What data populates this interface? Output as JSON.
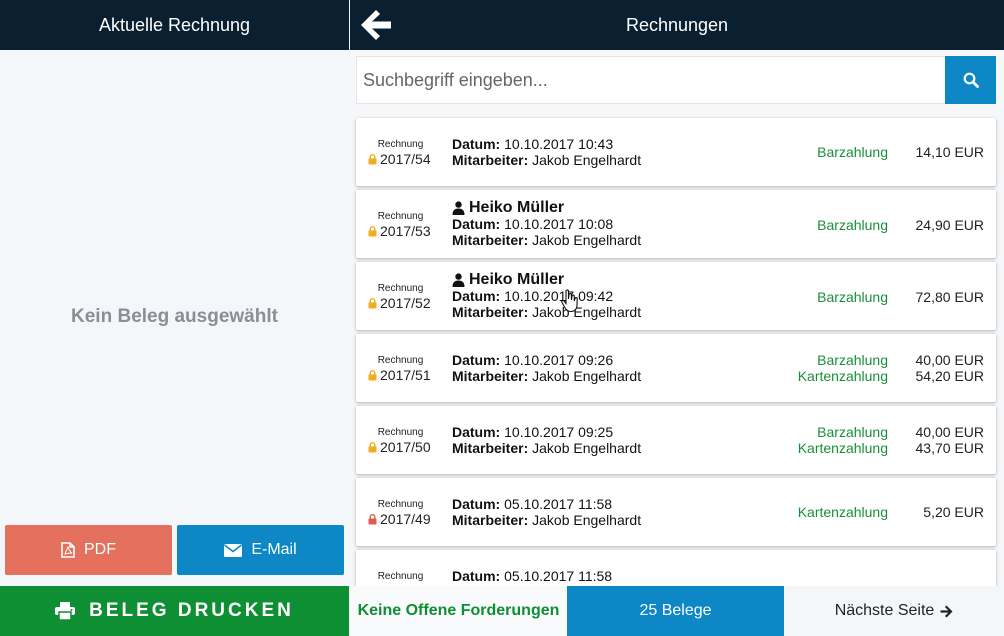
{
  "left": {
    "title": "Aktuelle Rechnung",
    "empty_message": "Kein Beleg ausgewählt",
    "pdf_label": "PDF",
    "email_label": "E-Mail",
    "print_label": "BELEG DRUCKEN"
  },
  "right": {
    "title": "Rechnungen",
    "search_placeholder": "Suchbegriff eingeben..."
  },
  "labels": {
    "datum": "Datum:",
    "mitarbeiter": "Mitarbeiter:"
  },
  "invoices": [
    {
      "type": "Rechnung",
      "number": "2017/54",
      "lock_color": "#f0ad1e",
      "customer": "",
      "datum": "10.10.2017 10:43",
      "mitarbeiter": "Jakob Engelhardt",
      "payments": [
        "Barzahlung"
      ],
      "amounts": [
        "14,10 EUR"
      ]
    },
    {
      "type": "Rechnung",
      "number": "2017/53",
      "lock_color": "#f0ad1e",
      "customer": "Heiko Müller",
      "datum": "10.10.2017 10:08",
      "mitarbeiter": "Jakob Engelhardt",
      "payments": [
        "Barzahlung"
      ],
      "amounts": [
        "24,90 EUR"
      ]
    },
    {
      "type": "Rechnung",
      "number": "2017/52",
      "lock_color": "#f0ad1e",
      "customer": "Heiko Müller",
      "datum": "10.10.2017 09:42",
      "mitarbeiter": "Jakob Engelhardt",
      "payments": [
        "Barzahlung"
      ],
      "amounts": [
        "72,80 EUR"
      ]
    },
    {
      "type": "Rechnung",
      "number": "2017/51",
      "lock_color": "#f0ad1e",
      "customer": "",
      "datum": "10.10.2017 09:26",
      "mitarbeiter": "Jakob Engelhardt",
      "payments": [
        "Barzahlung",
        "Kartenzahlung"
      ],
      "amounts": [
        "40,00 EUR",
        "54,20 EUR"
      ]
    },
    {
      "type": "Rechnung",
      "number": "2017/50",
      "lock_color": "#f0ad1e",
      "customer": "",
      "datum": "10.10.2017 09:25",
      "mitarbeiter": "Jakob Engelhardt",
      "payments": [
        "Barzahlung",
        "Kartenzahlung"
      ],
      "amounts": [
        "40,00 EUR",
        "43,70 EUR"
      ]
    },
    {
      "type": "Rechnung",
      "number": "2017/49",
      "lock_color": "#e05a4e",
      "customer": "",
      "datum": "05.10.2017 11:58",
      "mitarbeiter": "Jakob Engelhardt",
      "payments": [
        "Kartenzahlung"
      ],
      "amounts": [
        "5,20 EUR"
      ]
    },
    {
      "type": "Rechnung",
      "number": "",
      "lock_color": "#f0ad1e",
      "customer": "",
      "datum": "05.10.2017 11:58",
      "mitarbeiter": "",
      "payments": [],
      "amounts": []
    }
  ],
  "footer": {
    "status": "Keine Offene Forderungen",
    "count": "25 Belege",
    "next_label": "Nächste Seite"
  },
  "colors": {
    "header_bg": "#0a1f30",
    "accent_blue": "#0d87c6",
    "green": "#0f8f34",
    "pdf_red": "#e5705e",
    "payment_green": "#1a8f3a"
  },
  "icons": [
    "back-arrow-icon",
    "search-icon",
    "pdf-file-icon",
    "envelope-icon",
    "printer-icon",
    "lock-icon",
    "user-icon",
    "arrow-right-icon",
    "hand-cursor-icon"
  ]
}
